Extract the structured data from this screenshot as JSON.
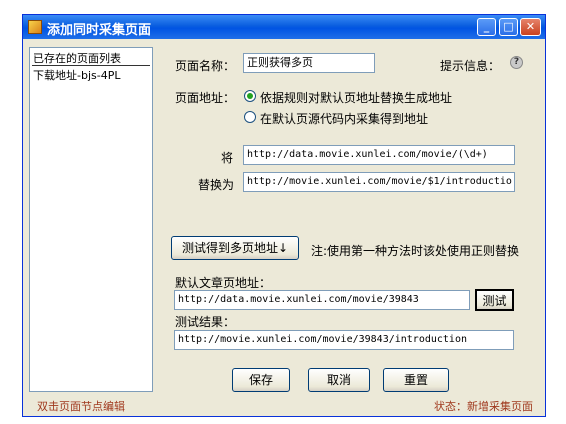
{
  "window": {
    "title": "添加同时采集页面"
  },
  "list": {
    "header": "已存在的页面列表",
    "items": [
      "下载地址-bjs-4PL"
    ]
  },
  "form": {
    "page_name_label": "页面名称：",
    "page_name_value": "正则获得多页",
    "hint_label": "提示信息：",
    "page_address_label": "页面地址：",
    "radio_rule": "依据规则对默认页地址替换生成地址",
    "radio_source": "在默认页源代码内采集得到地址",
    "replace_from_label": "将",
    "replace_from_value": "http://data.movie.xunlei.com/movie/(\\d+)",
    "replace_to_label": "替换为",
    "replace_to_value": "http://movie.xunlei.com/movie/$1/introductio",
    "test_multi_button": "测试得到多页地址↓",
    "note": "注:使用第一种方法时该处使用正则替换",
    "default_url_label": "默认文章页地址：",
    "default_url_value": "http://data.movie.xunlei.com/movie/39843",
    "test_button": "测试",
    "test_result_label": "测试结果：",
    "test_result_value": "http://movie.xunlei.com/movie/39843/introduction"
  },
  "buttons": {
    "save": "保存",
    "cancel": "取消",
    "reset": "重置"
  },
  "footer": {
    "left": "双击页面节点编辑",
    "status": "状态：新增采集页面"
  }
}
